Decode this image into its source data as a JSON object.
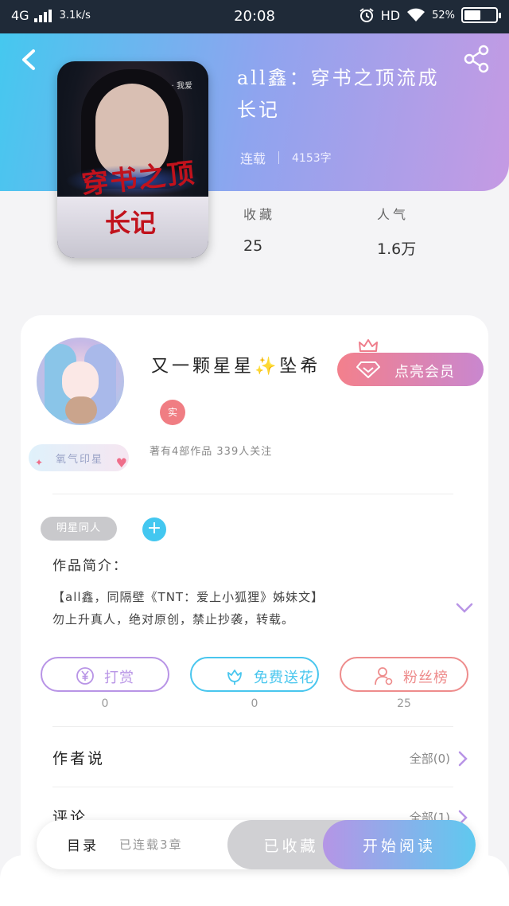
{
  "status_bar": {
    "network": "4G",
    "speed": "3.1k/s",
    "time": "20:08",
    "hd": "HD",
    "battery": "52%",
    "battery_level": 0.52
  },
  "header": {
    "back_icon": "chevron-left-icon",
    "share_icon": "share-icon"
  },
  "book": {
    "title": "all鑫：穿书之顶流成长记",
    "status": "连载",
    "word_count": "4153字",
    "cover": {
      "title_line1": "穿书之顶",
      "title_line2": "长记",
      "tag": "· 我爱"
    },
    "stats": [
      {
        "label": "收藏",
        "value": "25"
      },
      {
        "label": "人气",
        "value": "1.6万"
      }
    ]
  },
  "author": {
    "name": "又一颗星星✨坠希",
    "real_badge": "实",
    "badge": "氧气印星",
    "stats": "著有4部作品 339人关注",
    "vip_button": "点亮会员"
  },
  "tags": [
    "明星同人"
  ],
  "intro": {
    "title": "作品简介：",
    "text_line1": "【all鑫，同隔壁《TNT：爱上小狐狸》姊妹文】",
    "text_line2": "勿上升真人，绝对原创，禁止抄袭，转载。"
  },
  "actions": [
    {
      "label": "打赏",
      "count": "0",
      "icon": "yuan-icon",
      "color": "#b894e6"
    },
    {
      "label": "免费送花",
      "count": "0",
      "icon": "flower-icon",
      "color": "#49c6ee"
    },
    {
      "label": "粉丝榜",
      "count": "25",
      "icon": "user-rank-icon",
      "color": "#ee8c8c"
    }
  ],
  "sections": [
    {
      "title": "作者说",
      "right": "全部(0)"
    },
    {
      "title": "评论",
      "right": "全部(1)"
    }
  ],
  "bottom_bar": {
    "toc": "目录",
    "progress": "已连载3章",
    "favorited": "已收藏",
    "read": "开始阅读"
  }
}
